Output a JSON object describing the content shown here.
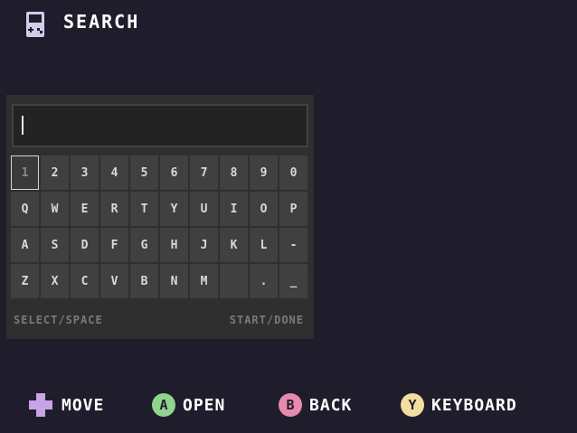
{
  "header": {
    "icon": "gameboy-icon",
    "title": "SEARCH"
  },
  "search": {
    "value": ""
  },
  "keyboard": {
    "rows": [
      [
        "1",
        "2",
        "3",
        "4",
        "5",
        "6",
        "7",
        "8",
        "9",
        "0"
      ],
      [
        "Q",
        "W",
        "E",
        "R",
        "T",
        "Y",
        "U",
        "I",
        "O",
        "P"
      ],
      [
        "A",
        "S",
        "D",
        "F",
        "G",
        "H",
        "J",
        "K",
        "L",
        "-"
      ],
      [
        "Z",
        "X",
        "C",
        "V",
        "B",
        "N",
        "M",
        " ",
        ".",
        "_"
      ]
    ],
    "selected_key": "1",
    "hint_left": "SELECT/SPACE",
    "hint_right": "START/DONE"
  },
  "footer": {
    "move": {
      "icon": "dpad-icon",
      "label": "MOVE",
      "color": "#c9a3e8"
    },
    "open": {
      "button": "A",
      "label": "OPEN",
      "color": "#8fd48f"
    },
    "back": {
      "button": "B",
      "label": "BACK",
      "color": "#e78aab"
    },
    "keyboard": {
      "button": "Y",
      "label": "KEYBOARD",
      "color": "#f2dfa0"
    }
  },
  "colors": {
    "background": "#1f1d2c",
    "panel": "#2f2f2f",
    "key": "#404040"
  }
}
